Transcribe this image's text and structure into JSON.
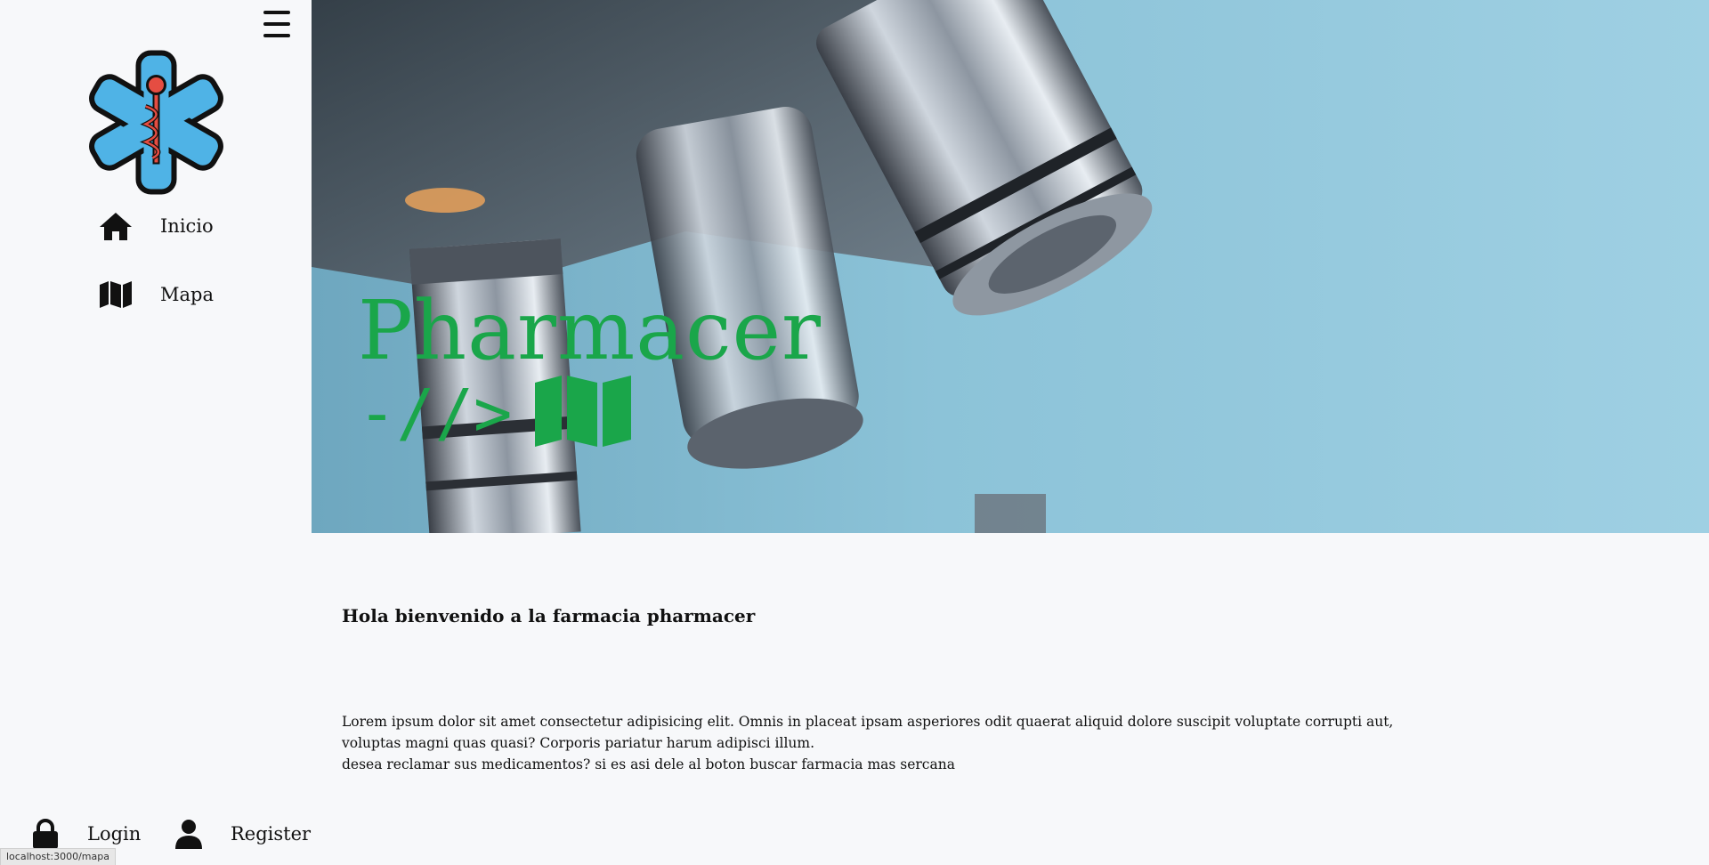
{
  "sidebar": {
    "menu_icon": "hamburger-menu-icon",
    "logo_icon": "star-of-life-caduceus-icon",
    "nav": [
      {
        "label": "Inicio",
        "icon": "home-icon"
      },
      {
        "label": "Mapa",
        "icon": "map-icon"
      }
    ],
    "auth": {
      "login_label": "Login",
      "login_icon": "lock-icon",
      "register_label": "Register",
      "register_icon": "user-icon"
    }
  },
  "hero": {
    "title": "Pharmacer",
    "code_text": "-//>",
    "map_icon": "map-icon",
    "accent_color": "#1aa64a"
  },
  "content": {
    "welcome": "Hola bienvenido a la farmacia pharmacer",
    "lines": [
      "Lorem ipsum dolor sit amet consectetur adipisicing elit. Omnis in placeat ipsam asperiores odit quaerat aliquid dolore suscipit voluptate corrupti aut,",
      "voluptas magni quas quasi? Corporis pariatur harum adipisci illum.",
      "desea reclamar sus medicamentos? si es asi dele al boton buscar farmacia mas sercana"
    ]
  },
  "status_bar": {
    "url": "localhost:3000/mapa"
  }
}
